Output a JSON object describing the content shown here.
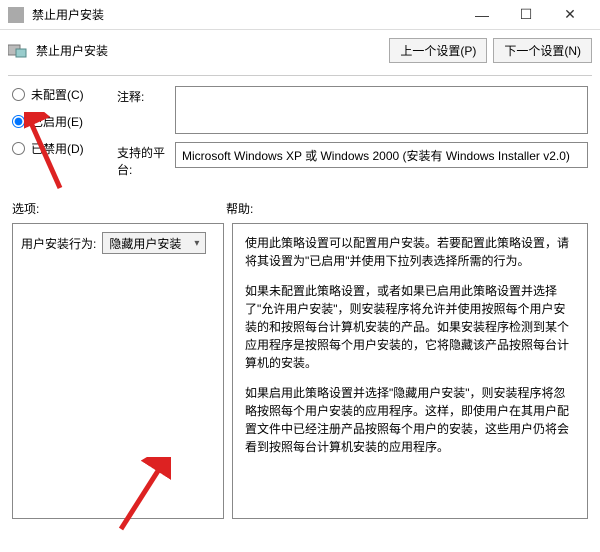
{
  "window": {
    "title": "禁止用户安装"
  },
  "header": {
    "title": "禁止用户安装",
    "prev_btn": "上一个设置(P)",
    "next_btn": "下一个设置(N)"
  },
  "radios": {
    "not_configured": "未配置(C)",
    "enabled": "已启用(E)",
    "disabled": "已禁用(D)",
    "selected": "enabled"
  },
  "fields": {
    "note_label": "注释:",
    "note_value": "",
    "platform_label": "支持的平台:",
    "platform_value": "Microsoft Windows XP 或 Windows 2000 (安装有 Windows Installer v2.0)"
  },
  "sections": {
    "options_label": "选项:",
    "help_label": "帮助:"
  },
  "options": {
    "behavior_label": "用户安装行为:",
    "behavior_value": "隐藏用户安装"
  },
  "help": {
    "p1": "使用此策略设置可以配置用户安装。若要配置此策略设置，请将其设置为\"已启用\"并使用下拉列表选择所需的行为。",
    "p2": "如果未配置此策略设置，或者如果已启用此策略设置并选择了\"允许用户安装\"，则安装程序将允许并使用按照每个用户安装的和按照每台计算机安装的产品。如果安装程序检测到某个应用程序是按照每个用户安装的，它将隐藏该产品按照每台计算机的安装。",
    "p3": "如果启用此策略设置并选择\"隐藏用户安装\"，则安装程序将忽略按照每个用户安装的应用程序。这样，即使用户在其用户配置文件中已经注册产品按照每个用户的安装，这些用户仍将会看到按照每台计算机安装的应用程序。"
  }
}
